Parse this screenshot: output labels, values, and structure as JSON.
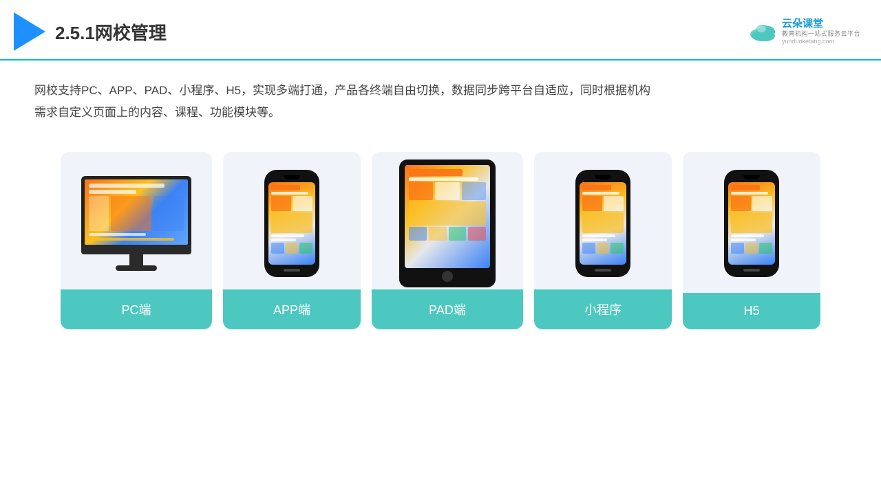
{
  "header": {
    "title": "2.5.1网校管理",
    "brand_name": "云朵课堂",
    "brand_subtitle": "教育机构一站\n式服务云平台",
    "brand_url": "yunduoketang.com"
  },
  "description": {
    "text_line1": "网校支持PC、APP、PAD、小程序、H5，实现多端打通，产品各终端自由切换，数据同步跨平台自适应，同时根据机构",
    "text_line2": "需求自定义页面上的内容、课程、功能模块等。"
  },
  "cards": [
    {
      "id": "pc",
      "label": "PC端"
    },
    {
      "id": "app",
      "label": "APP端"
    },
    {
      "id": "pad",
      "label": "PAD端"
    },
    {
      "id": "miniprogram",
      "label": "小程序"
    },
    {
      "id": "h5",
      "label": "H5"
    }
  ]
}
